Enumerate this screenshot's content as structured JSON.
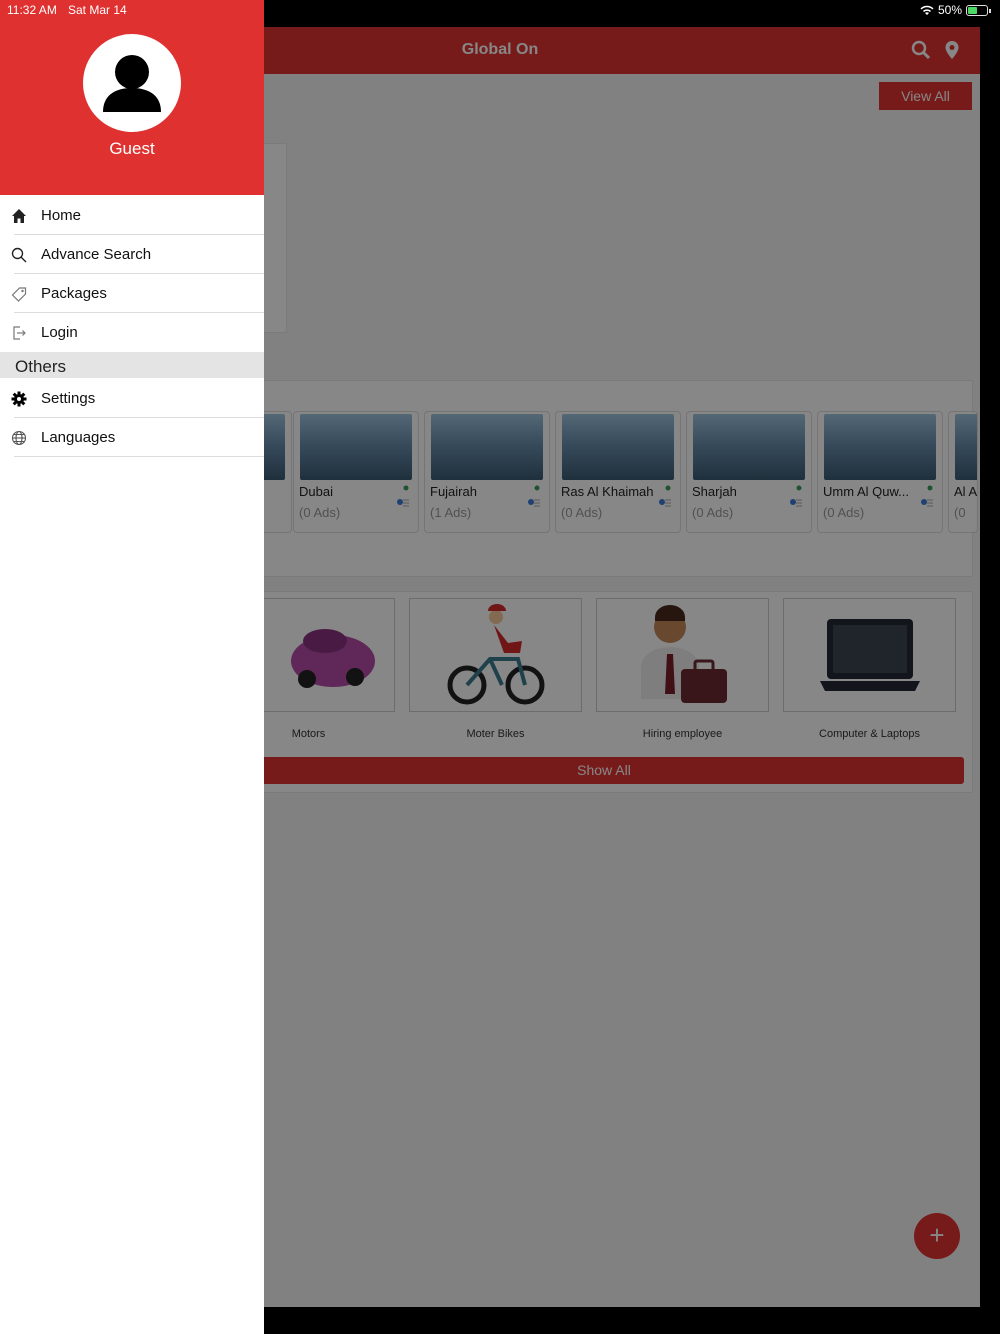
{
  "status_bar": {
    "time": "11:32 AM",
    "date": "Sat Mar 14",
    "battery": "50%"
  },
  "app": {
    "title": "Global On",
    "view_all_label": "View All",
    "cities": [
      {
        "name": "Dubai",
        "count": "(0 Ads)"
      },
      {
        "name": "Fujairah",
        "count": "(1 Ads)"
      },
      {
        "name": "Ras Al Khaimah",
        "count": "(0 Ads)"
      },
      {
        "name": "Sharjah",
        "count": "(0 Ads)"
      },
      {
        "name": "Umm Al Quw...",
        "count": "(0 Ads)"
      },
      {
        "name": "Al A",
        "count": "(0"
      }
    ],
    "categories": [
      {
        "label": "Motors"
      },
      {
        "label": "Moter Bikes"
      },
      {
        "label": "Hiring employee"
      },
      {
        "label": "Computer & Laptops"
      }
    ],
    "show_all_label": "Show All",
    "fab_label": "+"
  },
  "drawer": {
    "user_name": "Guest",
    "items": [
      {
        "label": "Home",
        "icon": "home-icon"
      },
      {
        "label": "Advance Search",
        "icon": "search-icon"
      },
      {
        "label": "Packages",
        "icon": "tag-icon"
      },
      {
        "label": "Login",
        "icon": "login-icon"
      }
    ],
    "section_title": "Others",
    "others_items": [
      {
        "label": "Settings",
        "icon": "gear-icon"
      },
      {
        "label": "Languages",
        "icon": "globe-icon"
      }
    ]
  },
  "colors": {
    "brand_red": "#e03131",
    "overlay": "rgba(0,0,0,0.47)"
  }
}
